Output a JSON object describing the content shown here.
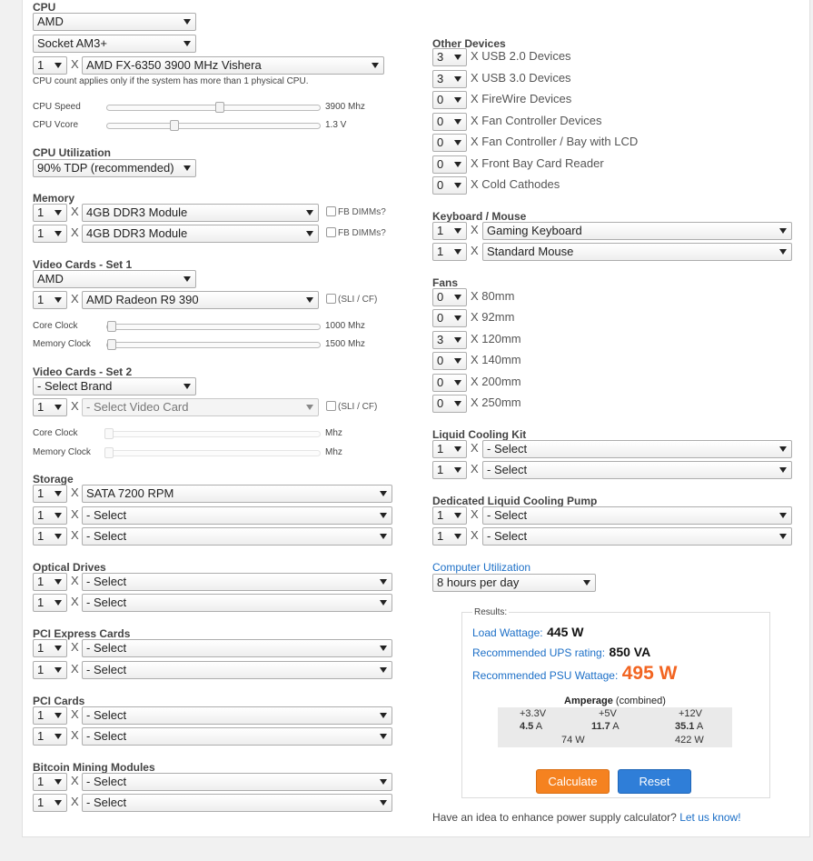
{
  "cpu": {
    "heading": "CPU",
    "brand": "AMD",
    "socket": "Socket AM3+",
    "count": "1",
    "x": "X",
    "model": "AMD FX-6350 3900 MHz Vishera",
    "note": "CPU count applies only if the system has more than 1 physical CPU.",
    "speed_label": "CPU Speed",
    "speed_value": "3900 Mhz",
    "vcore_label": "CPU Vcore",
    "vcore_value": "1.3 V",
    "utilization_heading": "CPU Utilization",
    "utilization": "90% TDP (recommended)"
  },
  "memory": {
    "heading": "Memory",
    "rows": [
      {
        "count": "1",
        "x": "X",
        "module": "4GB DDR3 Module",
        "fb": "FB DIMMs?"
      },
      {
        "count": "1",
        "x": "X",
        "module": "4GB DDR3 Module",
        "fb": "FB DIMMs?"
      }
    ]
  },
  "video1": {
    "heading": "Video Cards - Set 1",
    "brand": "AMD",
    "count": "1",
    "x": "X",
    "card": "AMD Radeon R9 390",
    "sli": "(SLI / CF)",
    "core_label": "Core Clock",
    "core_value": "1000 Mhz",
    "mem_label": "Memory Clock",
    "mem_value": "1500 Mhz"
  },
  "video2": {
    "heading": "Video Cards - Set 2",
    "brand": "- Select Brand",
    "count": "1",
    "x": "X",
    "card": "- Select Video Card",
    "sli": "(SLI / CF)",
    "core_label": "Core Clock",
    "core_value": "Mhz",
    "mem_label": "Memory Clock",
    "mem_value": "Mhz"
  },
  "storage": {
    "heading": "Storage",
    "rows": [
      {
        "count": "1",
        "x": "X",
        "item": "SATA 7200 RPM"
      },
      {
        "count": "1",
        "x": "X",
        "item": "- Select"
      },
      {
        "count": "1",
        "x": "X",
        "item": "- Select"
      }
    ]
  },
  "optical": {
    "heading": "Optical Drives",
    "rows": [
      {
        "count": "1",
        "x": "X",
        "item": "- Select"
      },
      {
        "count": "1",
        "x": "X",
        "item": "- Select"
      }
    ]
  },
  "pcie": {
    "heading": "PCI Express Cards",
    "rows": [
      {
        "count": "1",
        "x": "X",
        "item": "- Select"
      },
      {
        "count": "1",
        "x": "X",
        "item": "- Select"
      }
    ]
  },
  "pci": {
    "heading": "PCI Cards",
    "rows": [
      {
        "count": "1",
        "x": "X",
        "item": "- Select"
      },
      {
        "count": "1",
        "x": "X",
        "item": "- Select"
      }
    ]
  },
  "bitcoin": {
    "heading": "Bitcoin Mining Modules",
    "rows": [
      {
        "count": "1",
        "x": "X",
        "item": "- Select"
      },
      {
        "count": "1",
        "x": "X",
        "item": "- Select"
      }
    ]
  },
  "other": {
    "heading": "Other Devices",
    "rows": [
      {
        "count": "3",
        "label": "X USB 2.0 Devices"
      },
      {
        "count": "3",
        "label": "X USB 3.0 Devices"
      },
      {
        "count": "0",
        "label": "X FireWire Devices"
      },
      {
        "count": "0",
        "label": "X Fan Controller Devices"
      },
      {
        "count": "0",
        "label": "X Fan Controller / Bay with LCD"
      },
      {
        "count": "0",
        "label": "X Front Bay Card Reader"
      },
      {
        "count": "0",
        "label": "X Cold Cathodes"
      }
    ]
  },
  "keyboard": {
    "heading": "Keyboard / Mouse",
    "rows": [
      {
        "count": "1",
        "x": "X",
        "item": "Gaming Keyboard"
      },
      {
        "count": "1",
        "x": "X",
        "item": "Standard Mouse"
      }
    ]
  },
  "fans": {
    "heading": "Fans",
    "rows": [
      {
        "count": "0",
        "label": "X 80mm"
      },
      {
        "count": "0",
        "label": "X 92mm"
      },
      {
        "count": "3",
        "label": "X 120mm"
      },
      {
        "count": "0",
        "label": "X 140mm"
      },
      {
        "count": "0",
        "label": "X 200mm"
      },
      {
        "count": "0",
        "label": "X 250mm"
      }
    ]
  },
  "liquid_kit": {
    "heading": "Liquid Cooling Kit",
    "rows": [
      {
        "count": "1",
        "x": "X",
        "item": "- Select"
      },
      {
        "count": "1",
        "x": "X",
        "item": "- Select"
      }
    ]
  },
  "liquid_pump": {
    "heading": "Dedicated Liquid Cooling Pump",
    "rows": [
      {
        "count": "1",
        "x": "X",
        "item": "- Select"
      },
      {
        "count": "1",
        "x": "X",
        "item": "- Select"
      }
    ]
  },
  "computer_utilization": {
    "heading": "Computer Utilization",
    "value": "8 hours per day"
  },
  "results": {
    "heading": "Results:",
    "load_label": "Load Wattage:",
    "load_value": "445 W",
    "ups_label": "Recommended UPS rating:",
    "ups_value": "850 VA",
    "psu_label": "Recommended PSU Wattage:",
    "psu_value": "495 W",
    "amperage_title": "Amperage",
    "amperage_sub": "(combined)",
    "rails": [
      {
        "name": "+3.3V",
        "amp": "4.5",
        "unit": "A",
        "watts": ""
      },
      {
        "name": "+5V",
        "amp": "11.7",
        "unit": "A",
        "watts": "74 W"
      },
      {
        "name": "+12V",
        "amp": "35.1",
        "unit": "A",
        "watts": "422 W"
      }
    ],
    "calculate": "Calculate",
    "reset": "Reset"
  },
  "footer": {
    "text": "Have an idea to enhance power supply calculator?",
    "link": "Let us know!"
  },
  "colors": {
    "accent_blue": "#1c6fc7",
    "psu_orange": "#f26522",
    "calculate_button": "#f58220",
    "reset_button": "#2f7ed8"
  },
  "sliders": {
    "cpu_speed_fraction": 0.53,
    "cpu_vcore_fraction": 0.31,
    "core_clock_fraction": 0.0,
    "memory_clock_fraction": 0.0
  }
}
